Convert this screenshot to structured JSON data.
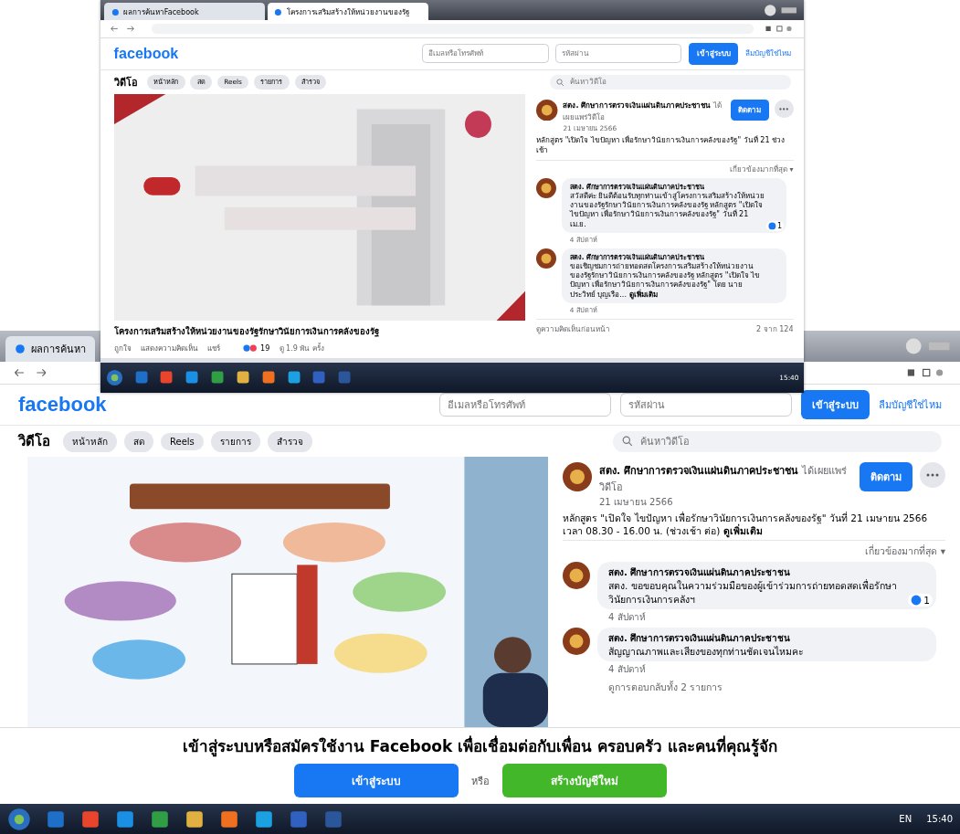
{
  "screens": [
    {
      "kind": "small",
      "tabs": [
        {
          "label": "ผลการค้นหาFacebook",
          "selected": false
        },
        {
          "label": "โครงการเสริมสร้างให้หน่วยงานของรัฐ",
          "selected": true
        }
      ],
      "header": {
        "logo": "facebook",
        "email_placeholder": "อีเมลหรือโทรศัพท์",
        "password_placeholder": "รหัสผ่าน",
        "login": "เข้าสู่ระบบ",
        "forgot": "ลืมบัญชีใช่ไหม"
      },
      "nav": {
        "title": "วิดีโอ",
        "items": [
          {
            "label": "หน้าหลัก",
            "selected": false
          },
          {
            "label": "สด",
            "selected": false
          },
          {
            "label": "Reels",
            "selected": false
          },
          {
            "label": "รายการ",
            "selected": false
          },
          {
            "label": "สำรวจ",
            "selected": false
          }
        ],
        "search_placeholder": "ค้นหาวิดีโอ"
      },
      "video": {
        "kind": "picture",
        "caption": "โครงการเสริมสร้างให้หน่วยงานของรัฐรักษาวินัยการเงินการคลังของรัฐ",
        "actions": [
          "ถูกใจ",
          "แสดงความคิดเห็น",
          "แชร์"
        ],
        "reaction_count": "19",
        "views": "ดู 1.9 พัน ครั้ง"
      },
      "post": {
        "author": "สตง. ศึกษาการตรวจเงินแผ่นดินภาคประชาชน",
        "badge": "ได้เผยแพร่วิดีโอ",
        "follow": "ติดตาม",
        "date": "21 เมษายน 2566",
        "text": "หลักสูตร \"เปิดใจ ไขปัญหา เพื่อรักษาวินัยการเงินการคลังของรัฐ\" วันที่ 21 ช่วงเช้า"
      },
      "sort": "เกี่ยวข้องมากที่สุด ▾",
      "comments": [
        {
          "author": "สตง. ศึกษาการตรวจเงินแผ่นดินภาคประชาชน",
          "text": "สวัสดีค่ะ ยินดีต้อนรับทุกท่านเข้าสู่โครงการเสริมสร้างให้หน่วยงานของรัฐรักษาวินัยการเงินการคลังของรัฐ หลักสูตร \"เปิดใจ ไขปัญหา เพื่อรักษาวินัยการเงินการคลังของรัฐ\" วันที่ 21 เม.ย.",
          "time": "4 สัปดาห์",
          "reactions": "1"
        },
        {
          "author": "สตง. ศึกษาการตรวจเงินแผ่นดินภาคประชาชน",
          "text": "ขอเชิญชมการถ่ายทอดสดโครงการเสริมสร้างให้หน่วยงานของรัฐรักษาวินัยการเงินการคลังของรัฐ หลักสูตร \"เปิดใจ ไขปัญหา เพื่อรักษาวินัยการเงินการคลังของรัฐ\" โดย นายประวิทย์ บุญเรือ... **ดูเพิ่มเติม**",
          "time": "4 สัปดาห์"
        }
      ],
      "more_comments": "ดูความคิดเห็นก่อนหน้า",
      "comment_count": "2 จาก 124",
      "clock": "15:40"
    },
    {
      "kind": "large",
      "tabs": [
        {
          "label": "ผลการค้นหา",
          "selected": false
        }
      ],
      "header": {
        "logo": "facebook",
        "email_placeholder": "อีเมลหรือโทรศัพท์",
        "password_placeholder": "รหัสผ่าน",
        "login": "เข้าสู่ระบบ",
        "forgot": "ลืมบัญชีใช่ไหม"
      },
      "nav": {
        "title": "วิดีโอ",
        "items": [
          {
            "label": "หน้าหลัก",
            "selected": false
          },
          {
            "label": "สด",
            "selected": false
          },
          {
            "label": "Reels",
            "selected": false
          },
          {
            "label": "รายการ",
            "selected": false
          },
          {
            "label": "สำรวจ",
            "selected": false
          }
        ],
        "search_placeholder": "ค้นหาวิดีโอ"
      },
      "video": {
        "kind": "picture"
      },
      "post": {
        "author": "สตง. ศึกษาการตรวจเงินแผ่นดินภาคประชาชน",
        "badge": "ได้เผยแพร่วิดีโอ",
        "follow": "ติดตาม",
        "date": "21 เมษายน 2566",
        "text": "หลักสูตร \"เปิดใจ ไขปัญหา เพื่อรักษาวินัยการเงินการคลังของรัฐ\" วันที่ 21 เมษายน 2566 เวลา 08.30 - 16.00 น. (ช่วงเช้า ต่อ) **ดูเพิ่มเติม**"
      },
      "sort": "เกี่ยวข้องมากที่สุด ▾",
      "comments": [
        {
          "author": "สตง. ศึกษาการตรวจเงินแผ่นดินภาคประชาชน",
          "text": "สตง. ขอขอบคุณในความร่วมมือของผู้เข้าร่วมการถ่ายทอดสดเพื่อรักษาวินัยการเงินการคลังฯ",
          "time": "4 สัปดาห์",
          "reactions": "1"
        },
        {
          "author": "สตง. ศึกษาการตรวจเงินแผ่นดินภาคประชาชน",
          "text": "สัญญาณภาพและเสียงของทุกท่านชัดเจนไหมคะ",
          "time": "4 สัปดาห์"
        }
      ],
      "replies": "ดูการตอบกลับทั้ง 2 รายการ",
      "banner": {
        "text": "เข้าสู่ระบบหรือสมัครใช้งาน Facebook เพื่อเชื่อมต่อกับเพื่อน ครอบครัว และคนที่คุณรู้จัก",
        "login": "เข้าสู่ระบบ",
        "or": "หรือ",
        "signup": "สร้างบัญชีใหม่"
      },
      "tray_lang": "EN",
      "clock": "15:40"
    }
  ]
}
